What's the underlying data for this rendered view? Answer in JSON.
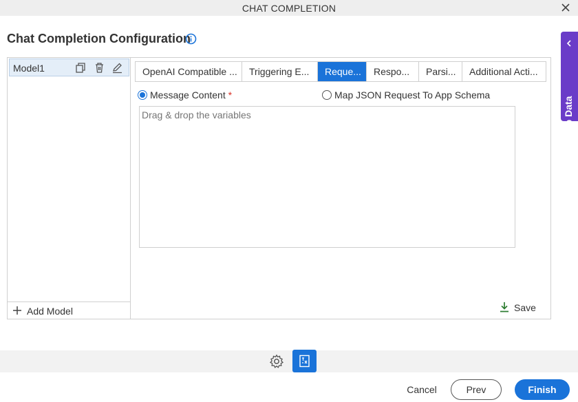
{
  "window": {
    "title": "CHAT COMPLETION",
    "close_icon": "close-icon"
  },
  "page": {
    "heading": "Chat Completion Configuration",
    "info_icon": "info-icon"
  },
  "side_panel": {
    "label": "App Data",
    "icon": "chevron-left-icon",
    "color": "#6a3cc8"
  },
  "models": {
    "items": [
      {
        "name": "Model1",
        "icons": [
          "copy-icon",
          "trash-icon",
          "edit-icon"
        ]
      }
    ],
    "add_label": "Add Model"
  },
  "tabs": [
    {
      "label": "OpenAI Compatible ...",
      "active": false
    },
    {
      "label": "Triggering E...",
      "active": false
    },
    {
      "label": "Reque...",
      "active": true
    },
    {
      "label": "Respo...",
      "active": false
    },
    {
      "label": "Parsi...",
      "active": false
    },
    {
      "label": "Additional Acti...",
      "active": false
    }
  ],
  "request": {
    "option_message": "Message Content",
    "required_mark": "*",
    "option_map": "Map JSON Request To App Schema",
    "selected": "message",
    "placeholder": "Drag & drop the variables",
    "value": ""
  },
  "save_label": "Save",
  "footer": {
    "cancel": "Cancel",
    "prev": "Prev",
    "finish": "Finish"
  },
  "colors": {
    "accent": "#1a73d9",
    "save_green": "#2e7d32"
  }
}
